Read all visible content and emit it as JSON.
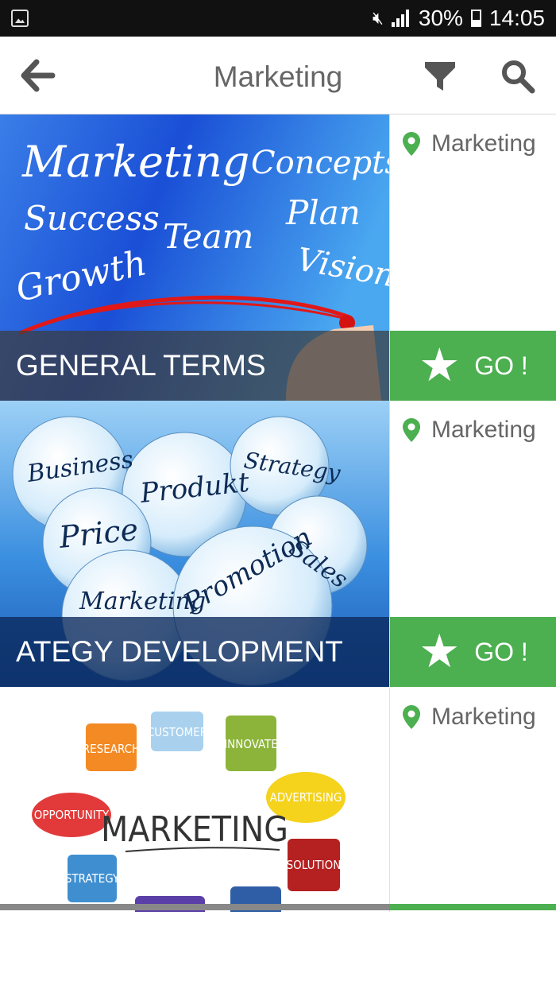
{
  "status_bar": {
    "battery": "30%",
    "time": "14:05",
    "icons": [
      "gallery-icon",
      "mute-icon",
      "signal-icon",
      "battery-icon"
    ]
  },
  "header": {
    "title": "Marketing",
    "back_icon": "arrow-left-icon",
    "filter_icon": "funnel-icon",
    "search_icon": "search-icon"
  },
  "cards": [
    {
      "caption": "GENERAL TERMS",
      "location": "Marketing",
      "go_label": "GO !",
      "image_words": [
        "Marketing",
        "Concepts",
        "Success",
        "Plan",
        "Team",
        "Growth",
        "Vision"
      ]
    },
    {
      "caption": "ATEGY DEVELOPMENT",
      "location": "Marketing",
      "go_label": "GO !",
      "image_words": [
        "Business",
        "Produkt",
        "Strategy",
        "Price",
        "Sales",
        "Marketing",
        "Promotion"
      ]
    },
    {
      "caption": "",
      "location": "Marketing",
      "go_label": "",
      "image_words": [
        "CUSTOMER",
        "RESEARCH",
        "INNOVATE",
        "ADVERTISING",
        "OPPORTUNITY",
        "MARKETING",
        "STRATEGY",
        "SOLUTION"
      ]
    }
  ],
  "colors": {
    "accent_green": "#4caf50",
    "status_bar": "#111111",
    "pin_green": "#4caf50"
  }
}
